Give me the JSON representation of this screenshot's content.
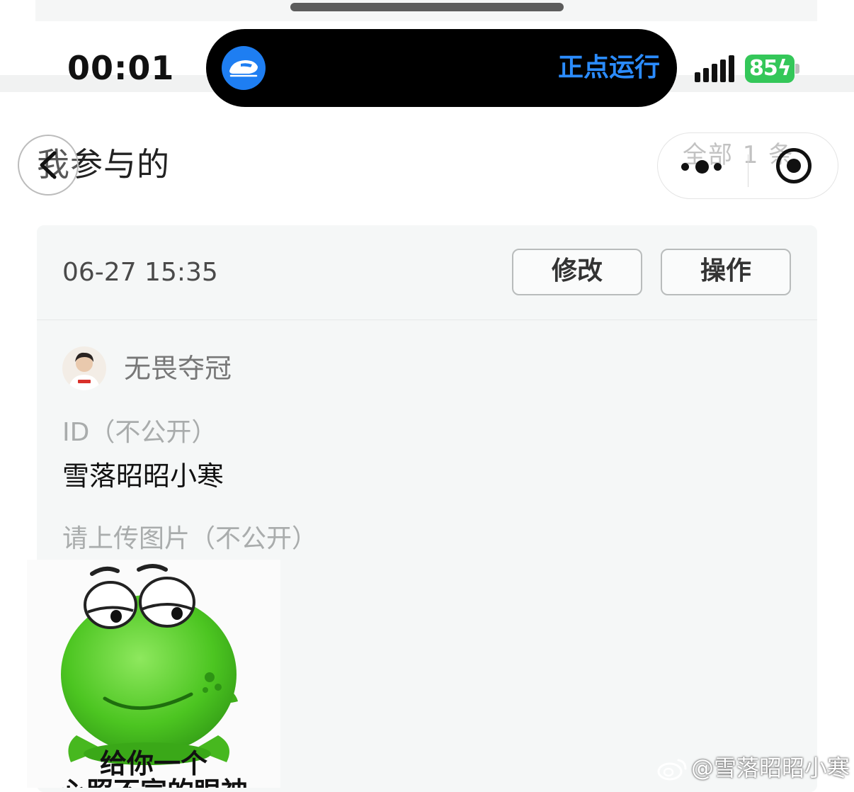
{
  "status_bar": {
    "time": "00:01",
    "live_activity_text": "正点运行",
    "battery": "85"
  },
  "header": {
    "title": "我参与的",
    "count_text": "全部 1 条"
  },
  "card": {
    "timestamp": "06-27 15:35",
    "edit_label": "修改",
    "action_label": "操作",
    "username": "无畏夺冠",
    "id_label": "ID（不公开）",
    "id_value": "雪落昭昭小寒",
    "upload_label": "请上传图片（不公开）",
    "image_caption_line1": "给你一个",
    "image_caption_line2": "心照不宣的眼神"
  },
  "watermark": "@雪落昭昭小寒",
  "colors": {
    "accent_blue": "#2b8cff",
    "battery_green": "#34c759",
    "frog_green": "#4cc521"
  },
  "icons": [
    "train-icon",
    "chevron-left-icon",
    "more-dots-icon",
    "target-icon",
    "weibo-icon"
  ]
}
